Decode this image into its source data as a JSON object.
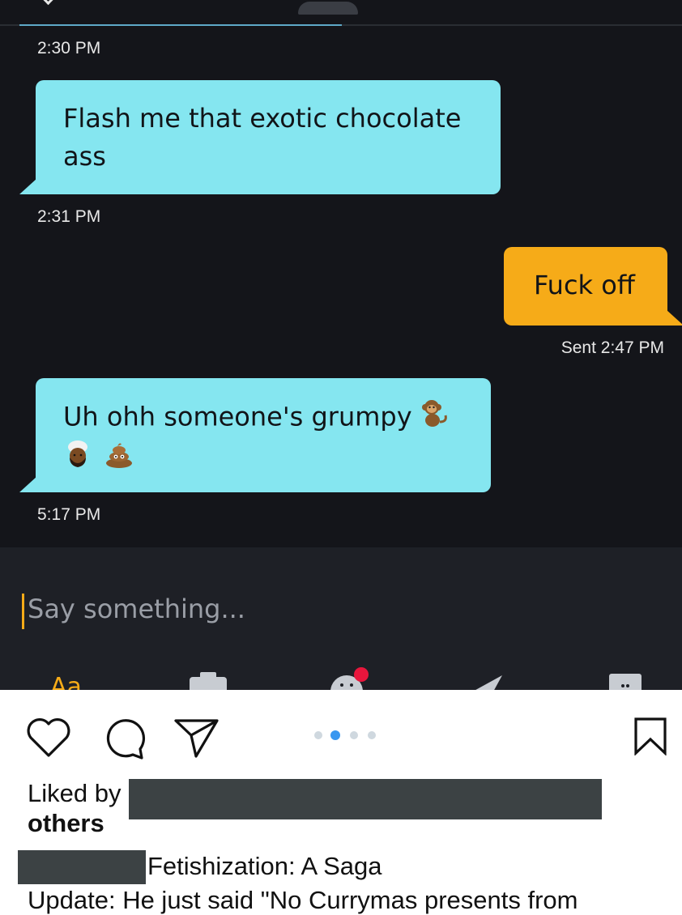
{
  "messages": [
    {
      "direction": "incoming",
      "text": "Flash me that exotic chocolate ass",
      "time": "2:30 PM"
    },
    {
      "direction": "outgoing",
      "text": "Fuck off",
      "time": "Sent 2:47 PM"
    },
    {
      "direction": "incoming",
      "text": "Uh ohh someone's grumpy",
      "emojis": [
        "monkey-icon",
        "person-with-turban-icon",
        "pile-of-poo-icon"
      ],
      "time": "5:17 PM"
    }
  ],
  "top_timestamp": "2:30 PM",
  "composer": {
    "placeholder": "Say something..."
  },
  "composer_tools": [
    "font-icon",
    "camera-icon",
    "sticker-icon",
    "send-icon",
    "grid-icon"
  ],
  "instagram": {
    "likes_prefix": "Liked by",
    "likes_suffix": "others",
    "caption_title": "Fetishization: A Saga",
    "caption_body": "Update: He just said \"No Currymas presents from",
    "carousel_pages": 4,
    "carousel_active_index": 1,
    "colors": {
      "like_accent": "#3897f0",
      "incoming_bubble": "#85e6f0",
      "outgoing_bubble": "#f6ab18",
      "chat_bg": "#14151a"
    }
  }
}
